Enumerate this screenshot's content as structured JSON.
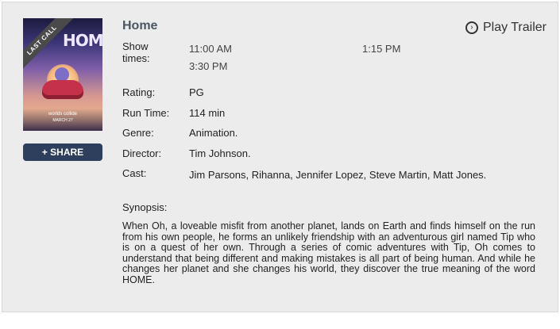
{
  "poster": {
    "ribbon": "LAST CALL",
    "title_art": "HOME",
    "small_line1": "worlds collide",
    "small_line2": "MARCH 27"
  },
  "share_label": "+ SHARE",
  "movie": {
    "title": "Home",
    "play_trailer_label": "Play Trailer",
    "show_times_label": "Show times:",
    "show_times": [
      "11:00 AM",
      "1:15 PM",
      "3:30 PM"
    ],
    "rating_label": "Rating:",
    "rating": "PG",
    "runtime_label": "Run Time:",
    "runtime": "114 min",
    "genre_label": "Genre:",
    "genre": "Animation.",
    "director_label": "Director:",
    "director": "Tim Johnson.",
    "cast_label": "Cast:",
    "cast": "Jim Parsons, Rihanna, Jennifer Lopez, Steve Martin, Matt Jones.",
    "synopsis_label": "Synopsis:",
    "synopsis": "When Oh, a loveable misfit from another planet, lands on Earth and finds himself on the run from his own people, he forms an unlikely friendship with an adventurous girl named Tip who is on a quest of her own. Through a series of comic adventures with Tip, Oh comes to understand that being different and making mistakes is all part of being human. And while he changes her planet and she changes his world, they discover the true meaning of the word HOME."
  }
}
